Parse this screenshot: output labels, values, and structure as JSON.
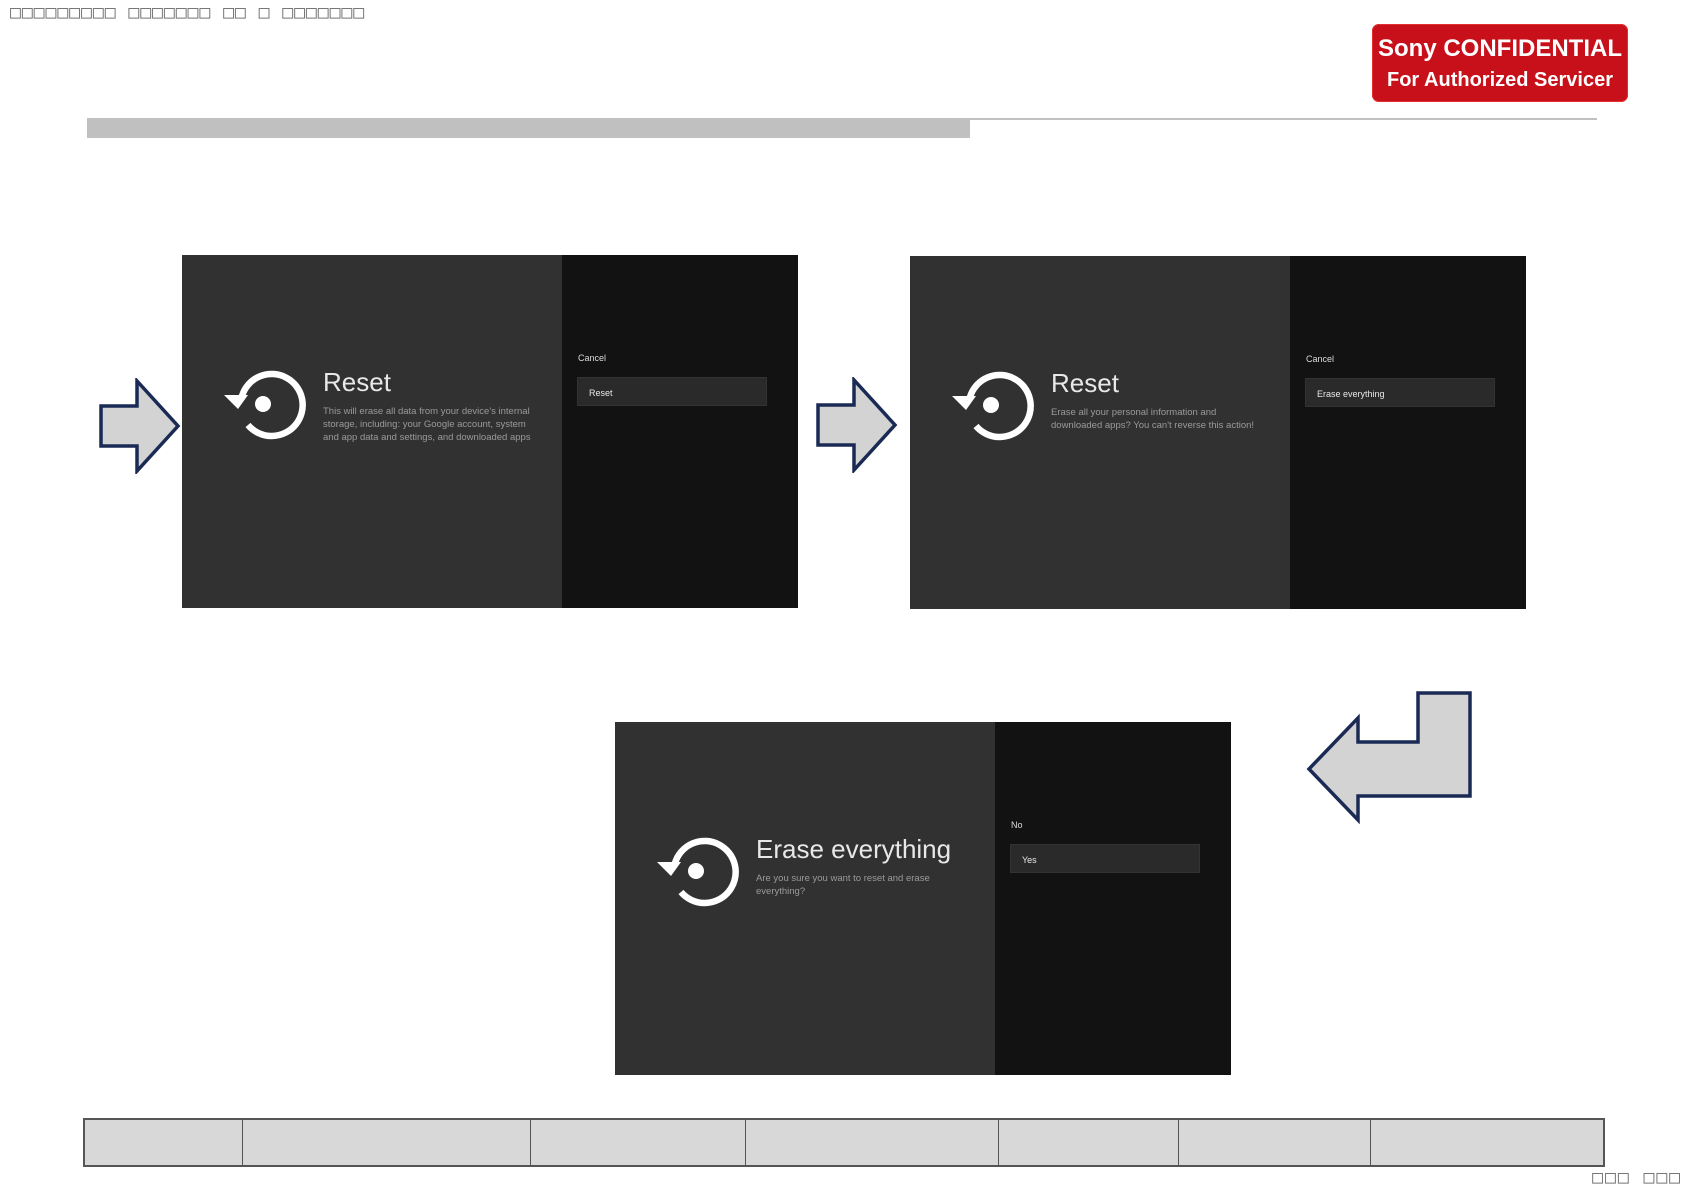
{
  "header": {
    "title_text": "□□□□□□□□□ □□□□□□□ □□ □ □□□□□□□",
    "confidential_line1": "Sony CONFIDENTIAL",
    "confidential_line2": "For Authorized Servicer",
    "confidential_color": "#c8101a"
  },
  "screens": [
    {
      "icon": "reset-restore-icon",
      "title": "Reset",
      "description": "This will erase all data from your device's internal storage, including: your Google account, system and app data and settings, and downloaded apps",
      "options": [
        "Cancel",
        "Reset"
      ],
      "selected_index": 1
    },
    {
      "icon": "reset-restore-icon",
      "title": "Reset",
      "description": "Erase all your personal information and downloaded apps? You can't reverse this action!",
      "options": [
        "Cancel",
        "Erase everything"
      ],
      "selected_index": 1
    },
    {
      "icon": "reset-restore-icon",
      "title": "Erase everything",
      "description": "Are you sure you want to reset and erase everything?",
      "options": [
        "No",
        "Yes"
      ],
      "selected_index": 1
    }
  ],
  "arrows": [
    "right-arrow-icon",
    "right-arrow-icon",
    "return-left-arrow-icon"
  ],
  "footer": {
    "cells": [
      "",
      "",
      "",
      "",
      "",
      "",
      ""
    ]
  },
  "page_number": "□□□ □□□",
  "colors": {
    "screen_bg": "#313131",
    "screen_panel": "#121212",
    "arrow_fill": "#d3d3d3",
    "arrow_stroke": "#1a2a55"
  }
}
